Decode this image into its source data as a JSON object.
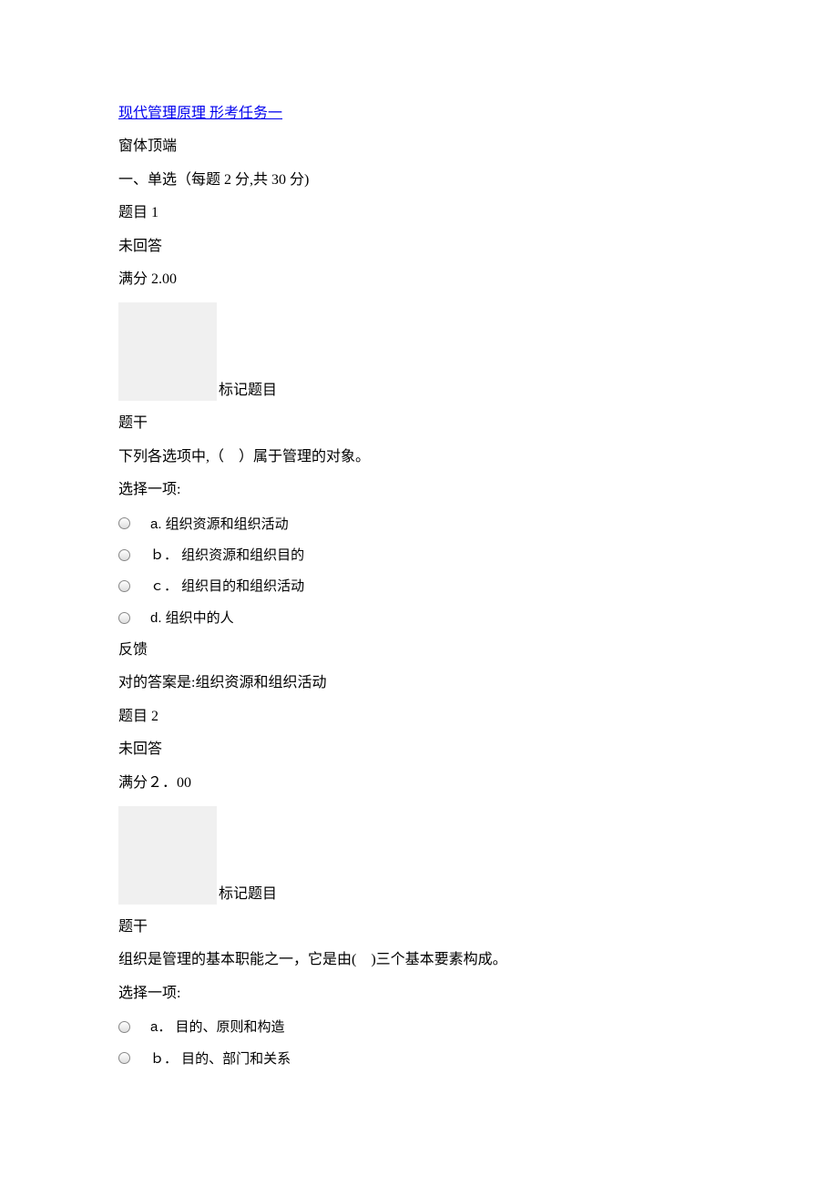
{
  "title": "现代管理原理 形考任务一",
  "windowTop": "窗体顶端",
  "sectionHeader": "一、单选（每题 2 分,共 30 分)",
  "markLabel": "标记题目",
  "stemLabel": "题干",
  "selectPrompt": "选择一项:",
  "feedbackLabel": "反馈",
  "q1": {
    "num": "题目 1",
    "status": "未回答",
    "score": "满分 2.00",
    "stem": "下列各选项中,（　）属于管理的对象。",
    "options": {
      "a": "a. 组织资源和组织活动",
      "b": "ｂ． 组织资源和组织目的",
      "c": "ｃ． 组织目的和组织活动",
      "d": "d. 组织中的人"
    },
    "answer": "对的答案是:组织资源和组织活动"
  },
  "q2": {
    "num": "题目 2",
    "status": "未回答",
    "score": "满分２．00",
    "stem": "组织是管理的基本职能之一，它是由(　)三个基本要素构成。",
    "options": {
      "a": "a． 目的、原则和构造",
      "b": "ｂ． 目的、部门和关系"
    }
  }
}
